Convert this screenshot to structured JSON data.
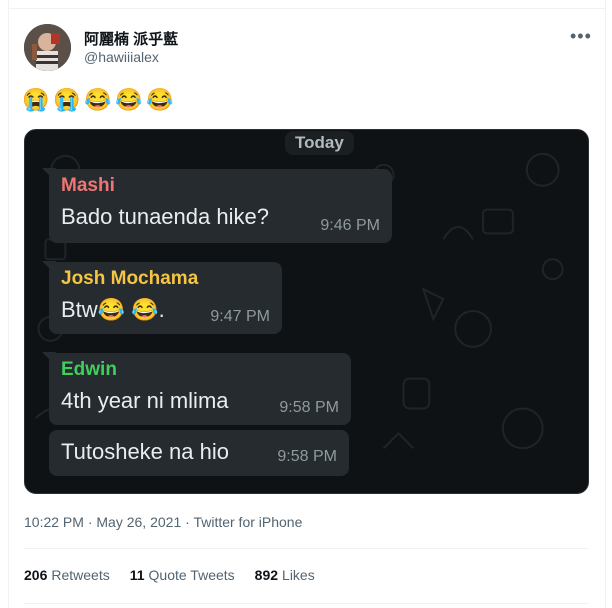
{
  "author": {
    "display_name": "阿麗楠 派乎藍",
    "handle": "@hawiiialex"
  },
  "more_icon": "ellipsis-icon",
  "tweet_emojis": [
    "😭",
    "😭",
    "😂",
    "😂",
    "😂"
  ],
  "screenshot": {
    "date_label": "Today",
    "messages": [
      {
        "sender": "Mashi",
        "sender_color": "#f07575",
        "text": "Bado tunaenda hike?",
        "time": "9:46 PM"
      },
      {
        "sender": "Josh Mochama",
        "sender_color": "#f5c542",
        "text": "Btw😂 😂.",
        "time": "9:47 PM"
      },
      {
        "sender": "Edwin",
        "sender_color": "#3fcf5c",
        "text": "4th year ni mlima",
        "time": "9:58 PM"
      },
      {
        "sender": "",
        "text": "Tutosheke na hio",
        "time": "9:58 PM"
      }
    ]
  },
  "meta": {
    "time": "10:22 PM",
    "sep": "·",
    "date": "May 26, 2021",
    "source": "Twitter for iPhone"
  },
  "stats": {
    "retweets_count": "206",
    "retweets_label": "Retweets",
    "quotes_count": "11",
    "quotes_label": "Quote Tweets",
    "likes_count": "892",
    "likes_label": "Likes"
  },
  "colors": {
    "accent": "#1d9bf0",
    "text_secondary": "#536471",
    "chat_background": "#0f1215",
    "bubble": "#252b2e"
  }
}
